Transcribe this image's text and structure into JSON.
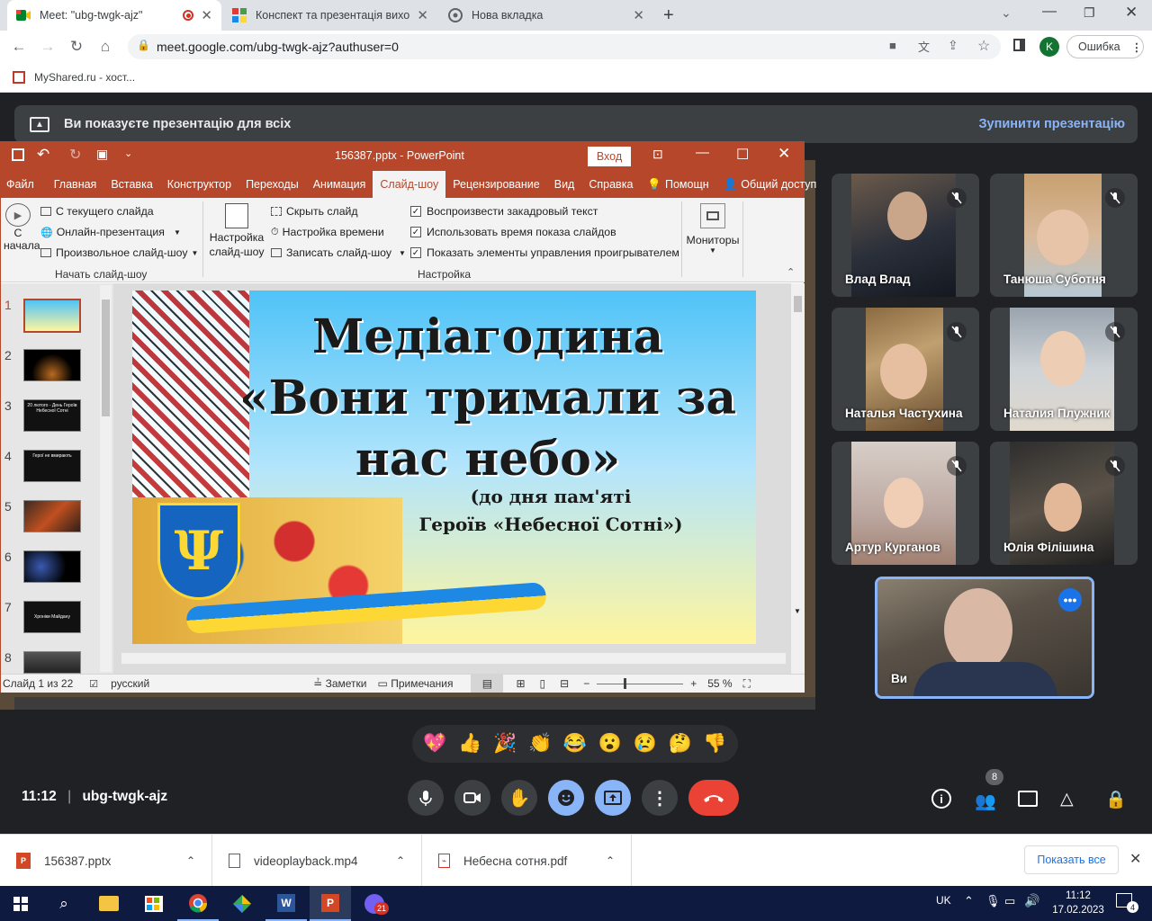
{
  "browser": {
    "tabs": [
      {
        "title": "Meet: \"ubg-twgk-ajz\""
      },
      {
        "title": "Конспект та презентація вихов"
      },
      {
        "title": "Нова вкладка"
      }
    ],
    "url": "meet.google.com/ubg-twgk-ajz?authuser=0",
    "profile_initial": "K",
    "error_label": "Ошибка",
    "bookmark": "MyShared.ru - хост..."
  },
  "meet": {
    "banner_text": "Ви показуєте презентацію для всіх",
    "stop_label": "Зупинити презентацію",
    "time": "11:12",
    "meeting_code": "ubg-twgk-ajz",
    "participant_count": "8",
    "participants": [
      {
        "name": "Влад Влад"
      },
      {
        "name": "Танюша Суботня"
      },
      {
        "name": "Наталья Частухина"
      },
      {
        "name": "Наталия Плужник"
      },
      {
        "name": "Артур Курганов"
      },
      {
        "name": "Юлія Філішина"
      },
      {
        "name": "Ви"
      }
    ],
    "reactions": [
      "💖",
      "👍",
      "🎉",
      "👏",
      "😂",
      "😮",
      "😢",
      "🤔",
      "👎"
    ]
  },
  "ppt": {
    "title": "156387.pptx  -  PowerPoint",
    "login": "Вход",
    "tabs": [
      "Файл",
      "Главная",
      "Вставка",
      "Конструктор",
      "Переходы",
      "Анимация",
      "Слайд-шоу",
      "Рецензирование",
      "Вид",
      "Справка",
      "Помощн",
      "Общий доступ"
    ],
    "ribbon": {
      "from_start": "С",
      "from_start2": "начала",
      "from_current": "С текущего слайда",
      "online": "Онлайн-презентация",
      "custom": "Произвольное слайд-шоу",
      "group1": "Начать слайд-шоу",
      "setup": "Настройка",
      "setup2": "слайд-шоу",
      "hide": "Скрыть слайд",
      "timing": "Настройка времени",
      "record": "Записать слайд-шоу",
      "narration": "Воспроизвести закадровый текст",
      "use_timing": "Использовать время показа слайдов",
      "show_controls": "Показать элементы управления проигрывателем",
      "group2": "Настройка",
      "monitors": "Мониторы"
    },
    "slide_numbers": [
      "1",
      "2",
      "3",
      "4",
      "5",
      "6",
      "7",
      "8"
    ],
    "slide": {
      "line1": "Медіагодина",
      "line2": "«Вони тримали за",
      "line3": "нас небо»",
      "line4": "(до дня пам'яті",
      "line5": "Героїв «Небесної Сотні»)"
    },
    "thumb_text": {
      "t3": "20 лютого - День Героїв Небесної Сотні",
      "t4": "Герої не вмирають",
      "t7": "Хроніки Майдану"
    },
    "status": {
      "slide": "Слайд 1 из 22",
      "lang": "русский",
      "notes": "Заметки",
      "comments": "Примечания",
      "zoom": "55 %"
    }
  },
  "downloads": [
    {
      "name": "156387.pptx"
    },
    {
      "name": "videoplayback.mp4"
    },
    {
      "name": "Небесна сотня.pdf"
    }
  ],
  "show_all": "Показать все",
  "taskbar": {
    "lang": "UK",
    "time": "11:12",
    "date": "17.02.2023",
    "viber_badge": "21",
    "notif": "4"
  },
  "colors": {
    "ppt_accent": "#b7472a",
    "meet_bg": "#202124",
    "meet_blue": "#8ab4f8",
    "hangup": "#ea4335"
  }
}
